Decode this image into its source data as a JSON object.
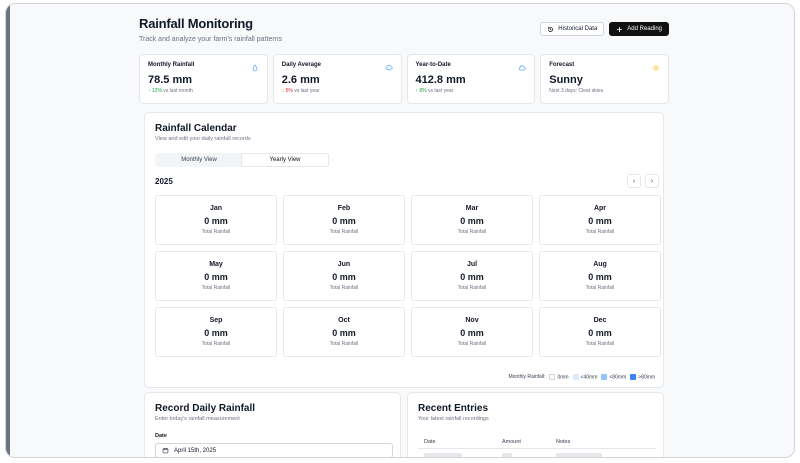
{
  "header": {
    "title": "Rainfall Monitoring",
    "subtitle": "Track and analyze your farm's rainfall patterns",
    "historical_label": "Historical Data",
    "add_label": "Add Reading"
  },
  "stats": [
    {
      "label": "Monthly Rainfall",
      "value": "78.5 mm",
      "trend": "↑ 12%",
      "trend_dir": "up",
      "note": " vs last month",
      "icon": "droplet-icon"
    },
    {
      "label": "Daily Average",
      "value": "2.6 mm",
      "trend": "↓ 5%",
      "trend_dir": "down",
      "note": " vs last year",
      "icon": "cloud-rain-icon"
    },
    {
      "label": "Year-to-Date",
      "value": "412.8 mm",
      "trend": "↑ 8%",
      "trend_dir": "up",
      "note": " vs last year",
      "icon": "cloud-icon"
    },
    {
      "label": "Forecast",
      "value": "Sunny",
      "trend": "",
      "trend_dir": "",
      "note": "Next 3 days: Clear skies",
      "icon": "sun-icon"
    }
  ],
  "calendar": {
    "title": "Rainfall Calendar",
    "subtitle": "View and edit your daily rainfall records",
    "view_monthly": "Monthly View",
    "view_yearly": "Yearly View",
    "active_view": "yearly",
    "year": "2025",
    "months": [
      {
        "name": "Jan",
        "value": "0 mm",
        "sub": "Total Rainfall"
      },
      {
        "name": "Feb",
        "value": "0 mm",
        "sub": "Total Rainfall"
      },
      {
        "name": "Mar",
        "value": "0 mm",
        "sub": "Total Rainfall"
      },
      {
        "name": "Apr",
        "value": "0 mm",
        "sub": "Total Rainfall"
      },
      {
        "name": "May",
        "value": "0 mm",
        "sub": "Total Rainfall"
      },
      {
        "name": "Jun",
        "value": "0 mm",
        "sub": "Total Rainfall"
      },
      {
        "name": "Jul",
        "value": "0 mm",
        "sub": "Total Rainfall"
      },
      {
        "name": "Aug",
        "value": "0 mm",
        "sub": "Total Rainfall"
      },
      {
        "name": "Sep",
        "value": "0 mm",
        "sub": "Total Rainfall"
      },
      {
        "name": "Oct",
        "value": "0 mm",
        "sub": "Total Rainfall"
      },
      {
        "name": "Nov",
        "value": "0 mm",
        "sub": "Total Rainfall"
      },
      {
        "name": "Dec",
        "value": "0 mm",
        "sub": "Total Rainfall"
      }
    ],
    "legend": {
      "label": "Monthly Rainfall:",
      "items": [
        {
          "label": "0mm",
          "color": "#f9fafb"
        },
        {
          "label": "<40mm",
          "color": "#dbeafe"
        },
        {
          "label": "<80mm",
          "color": "#93c5fd"
        },
        {
          "label": ">80mm",
          "color": "#3b82f6"
        }
      ]
    }
  },
  "record": {
    "title": "Record Daily Rainfall",
    "subtitle": "Enter today's rainfall measurement",
    "date_label": "Date",
    "date_value": "April 15th, 2025"
  },
  "recent": {
    "title": "Recent Entries",
    "subtitle": "Your latest rainfall recordings",
    "columns": [
      "Date",
      "Amount",
      "Notes"
    ]
  }
}
